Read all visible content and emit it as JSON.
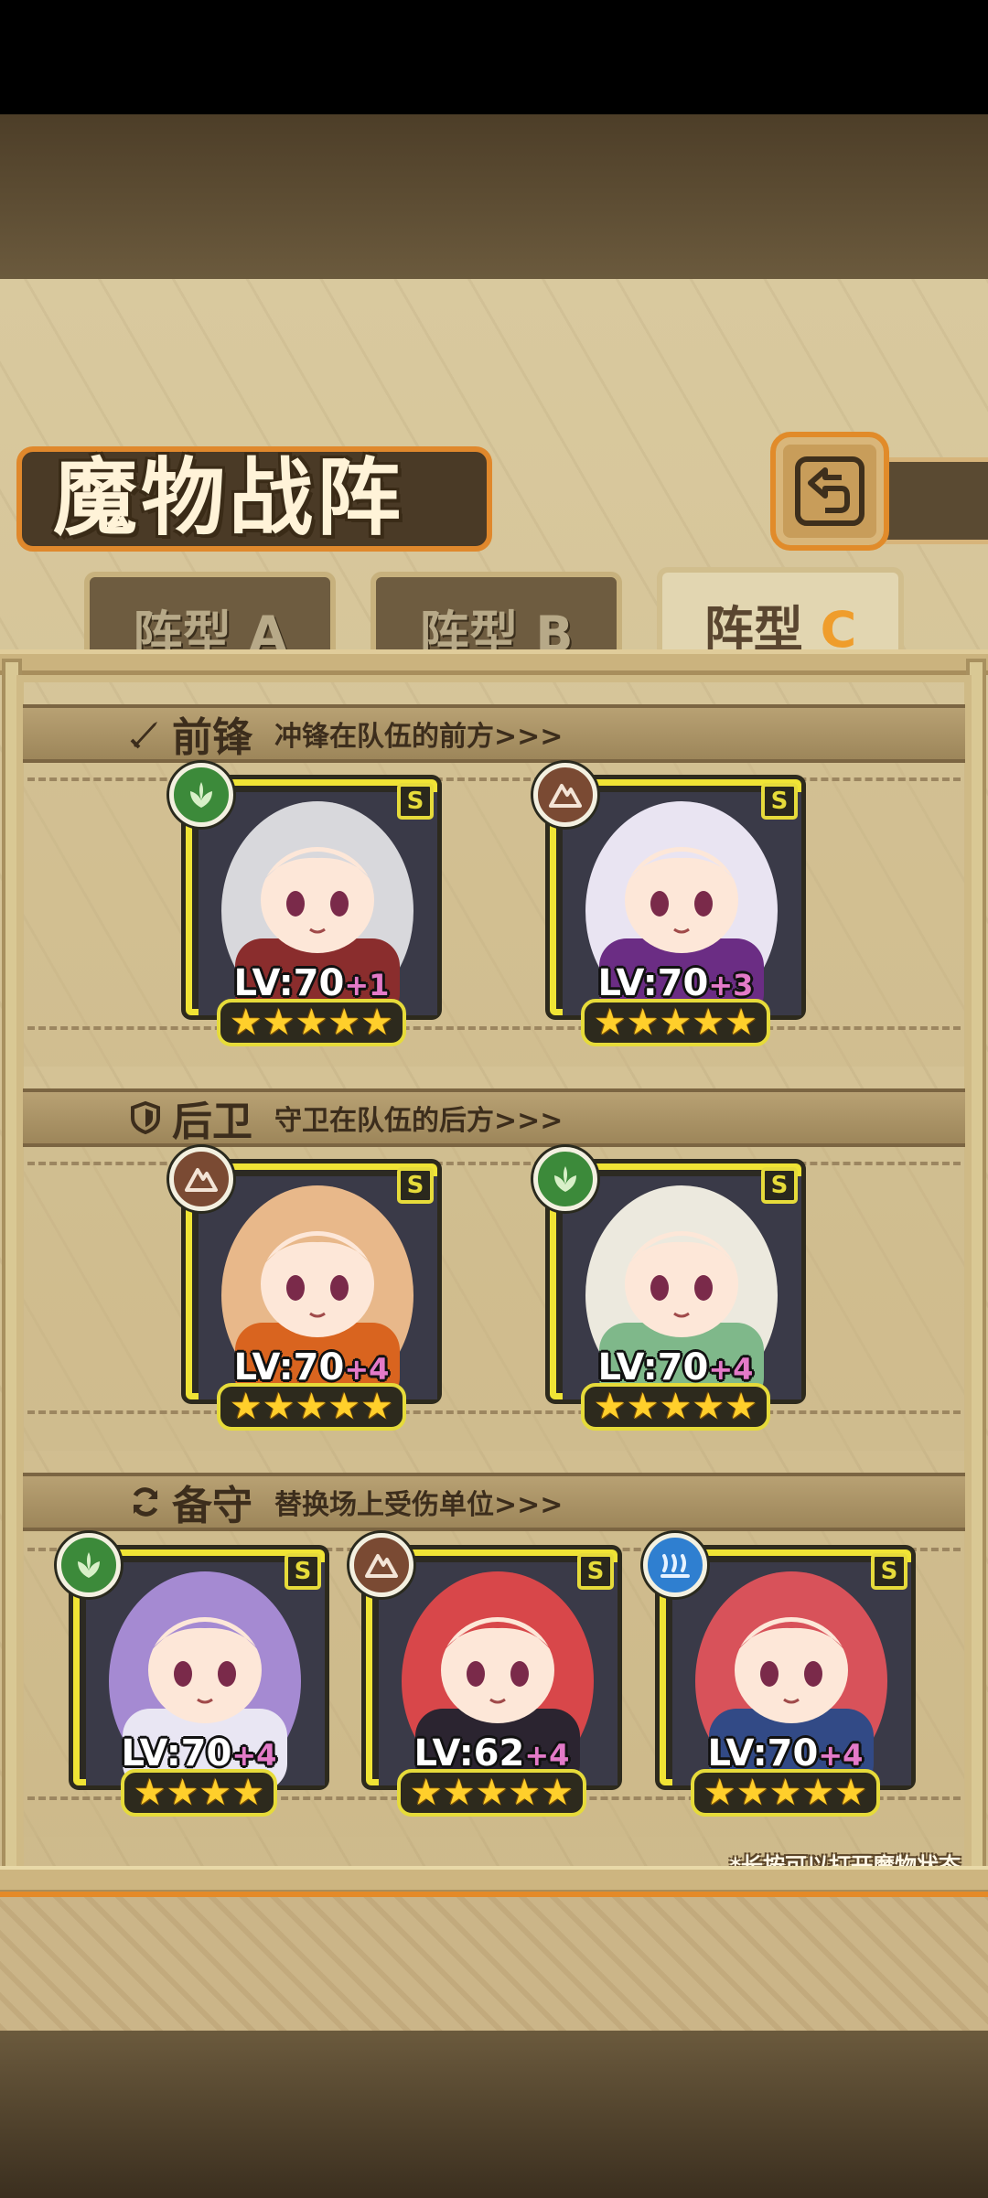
{
  "title": "魔物战阵",
  "tabs": [
    {
      "prefix": "阵型",
      "letter": "A",
      "active": false
    },
    {
      "prefix": "阵型",
      "letter": "B",
      "active": false
    },
    {
      "prefix": "阵型",
      "letter": "C",
      "active": true
    }
  ],
  "sections": [
    {
      "name": "前锋",
      "description": "冲锋在队伍的前方>>>",
      "icon": "sword-icon",
      "units": [
        {
          "element": "nature",
          "element_color": "#3c8a3a",
          "rank": "S",
          "level": "LV:70",
          "bonus": "+1",
          "stars": 5,
          "hair": "#d8d8dc",
          "outfit": "#8a2d2d"
        },
        {
          "element": "earth",
          "element_color": "#7a4a33",
          "rank": "S",
          "level": "LV:70",
          "bonus": "+3",
          "stars": 5,
          "hair": "#e9e4f2",
          "outfit": "#6b2d84"
        }
      ]
    },
    {
      "name": "后卫",
      "description": "守卫在队伍的后方>>>",
      "icon": "shield-icon",
      "units": [
        {
          "element": "earth",
          "element_color": "#7a4a33",
          "rank": "S",
          "level": "LV:70",
          "bonus": "+4",
          "stars": 5,
          "hair": "#e8b88a",
          "outfit": "#d9641f"
        },
        {
          "element": "nature",
          "element_color": "#3c8a3a",
          "rank": "S",
          "level": "LV:70",
          "bonus": "+4",
          "stars": 5,
          "hair": "#ece9de",
          "outfit": "#7fb88a"
        }
      ]
    },
    {
      "name": "备守",
      "description": "替换场上受伤单位>>>",
      "icon": "swap-icon",
      "units": [
        {
          "element": "nature",
          "element_color": "#3c8a3a",
          "rank": "S",
          "level": "LV:70",
          "bonus": "+4",
          "stars": 4,
          "hair": "#a58ad2",
          "outfit": "#e9e6f3"
        },
        {
          "element": "earth",
          "element_color": "#7a4a33",
          "rank": "S",
          "level": "LV:62",
          "bonus": "+4",
          "stars": 5,
          "hair": "#d8474a",
          "outfit": "#2b2430"
        },
        {
          "element": "water",
          "element_color": "#2f7fd0",
          "rank": "S",
          "level": "LV:70",
          "bonus": "+4",
          "stars": 5,
          "hair": "#d8525a",
          "outfit": "#324a86"
        }
      ]
    }
  ],
  "footnote": "*长按可以打开魔物状态"
}
